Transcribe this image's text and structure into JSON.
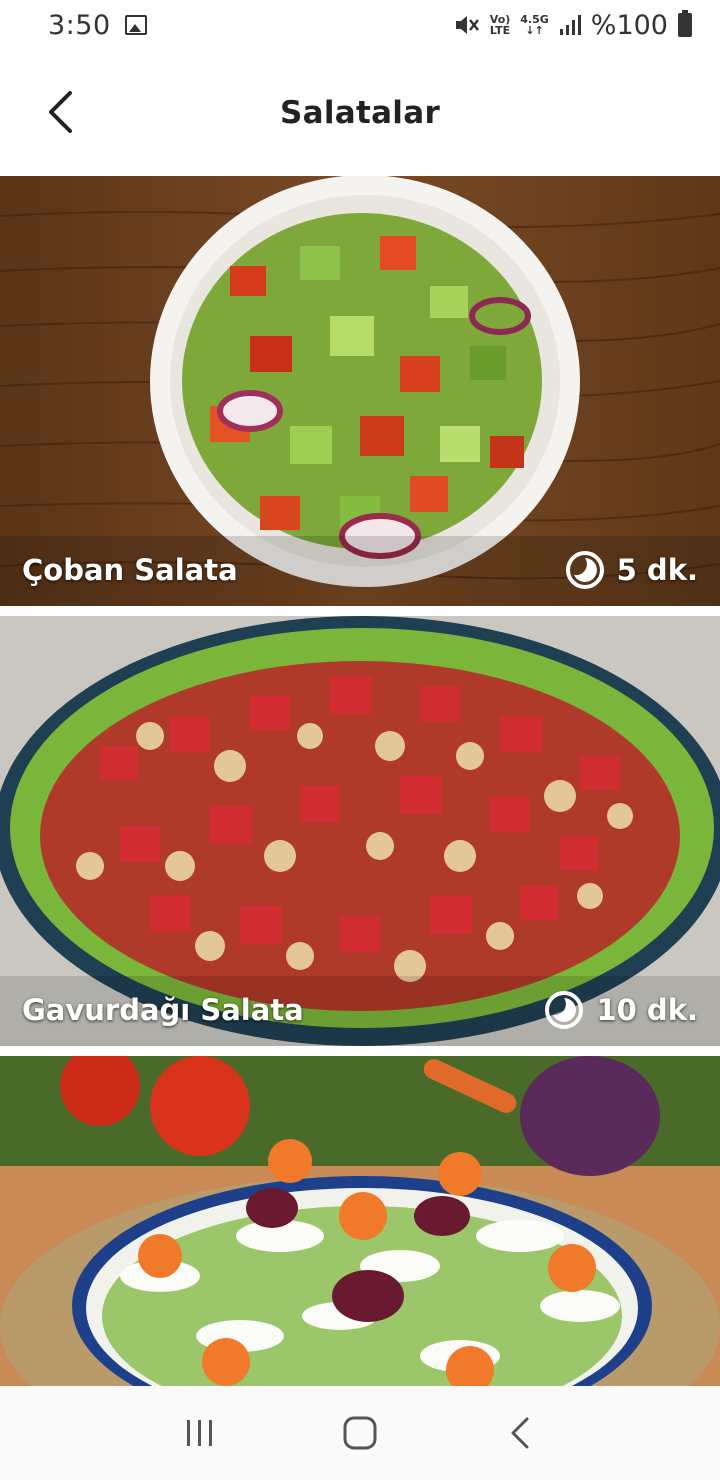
{
  "status_bar": {
    "time": "3:50",
    "network_top": "Vo)",
    "network_bottom": "LTE",
    "signal_top": "4.5G",
    "signal_bottom": "↓↑",
    "battery": "%100"
  },
  "header": {
    "title": "Salatalar"
  },
  "recipes": [
    {
      "name": "Çoban Salata",
      "duration": "5 dk."
    },
    {
      "name": "Gavurdağı Salata",
      "duration": "10 dk."
    },
    {
      "name": "",
      "duration": ""
    }
  ],
  "colors": {
    "background": "#ffffff",
    "text": "#222222",
    "overlay_text": "#ffffff"
  }
}
